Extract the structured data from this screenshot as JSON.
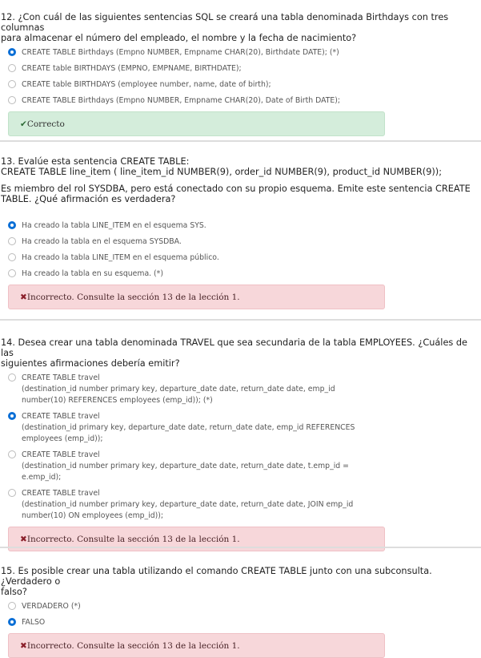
{
  "questions": [
    {
      "title": [
        "12. ¿Con cuál de las siguientes sentencias SQL se creará una tabla denominada Birthdays con tres columnas",
        "para almacenar el número del empleado, el nombre y la fecha de nacimiento?"
      ],
      "options": [
        {
          "lines": [
            "CREATE TABLE Birthdays (Empno NUMBER, Empname CHAR(20), Birthdate DATE); (*)"
          ],
          "selected": true
        },
        {
          "lines": [
            "CREATE table BIRTHDAYS (EMPNO, EMPNAME, BIRTHDATE);"
          ],
          "selected": false
        },
        {
          "lines": [
            "CREATE table BIRTHDAYS (employee number, name, date of birth);"
          ],
          "selected": false
        },
        {
          "lines": [
            "CREATE TABLE Birthdays (Empno NUMBER, Empname CHAR(20), Date of Birth DATE);"
          ],
          "selected": false
        }
      ],
      "feedback": {
        "icon": "✔",
        "text": "Correcto",
        "status": "correct"
      }
    },
    {
      "title": [
        "13. Evalúe esta sentencia CREATE TABLE:",
        "CREATE TABLE line_item ( line_item_id NUMBER(9), order_id NUMBER(9), product_id NUMBER(9));",
        "",
        "Es miembro del rol SYSDBA, pero está conectado con su propio esquema. Emite este sentencia CREATE",
        "TABLE. ¿Qué afirmación es verdadera?"
      ],
      "options": [
        {
          "lines": [
            "Ha creado la tabla LINE_ITEM en el esquema SYS."
          ],
          "selected": true
        },
        {
          "lines": [
            "Ha creado la tabla en el esquema SYSDBA."
          ],
          "selected": false
        },
        {
          "lines": [
            "Ha creado la tabla LINE_ITEM en el esquema público."
          ],
          "selected": false
        },
        {
          "lines": [
            "Ha creado la tabla en su esquema. (*)"
          ],
          "selected": false
        }
      ],
      "feedback": {
        "icon": "✖",
        "text": "Incorrecto. Consulte la sección 13 de la lección 1.",
        "status": "incorrect"
      }
    },
    {
      "title": [
        "14. Desea crear una tabla denominada TRAVEL que sea secundaria de la tabla EMPLOYEES. ¿Cuáles de las",
        "siguientes afirmaciones debería emitir?"
      ],
      "options": [
        {
          "lines": [
            "CREATE TABLE travel",
            "(destination_id number primary key, departure_date date, return_date date, emp_id",
            "number(10) REFERENCES employees (emp_id)); (*)"
          ],
          "selected": false
        },
        {
          "lines": [
            "CREATE TABLE travel",
            "(destination_id primary key, departure_date date, return_date date, emp_id REFERENCES",
            "employees (emp_id));"
          ],
          "selected": true
        },
        {
          "lines": [
            "CREATE TABLE travel",
            "(destination_id number primary key, departure_date date, return_date date, t.emp_id =",
            "e.emp_id);"
          ],
          "selected": false
        },
        {
          "lines": [
            "CREATE TABLE travel",
            "(destination_id number primary key, departure_date date, return_date date, JOIN emp_id",
            "number(10) ON employees (emp_id));"
          ],
          "selected": false
        }
      ],
      "feedback": {
        "icon": "✖",
        "text": "Incorrecto. Consulte la sección 13 de la lección 1.",
        "status": "incorrect"
      }
    },
    {
      "title": [
        "15. Es posible crear una tabla utilizando el comando CREATE TABLE junto con una subconsulta. ¿Verdadero o",
        "falso?"
      ],
      "options": [
        {
          "lines": [
            "VERDADERO (*)"
          ],
          "selected": false
        },
        {
          "lines": [
            "FALSO"
          ],
          "selected": true
        }
      ],
      "feedback": {
        "icon": "✖",
        "text": "Incorrecto. Consulte la sección 13 de la lección 1.",
        "status": "incorrect"
      }
    }
  ]
}
